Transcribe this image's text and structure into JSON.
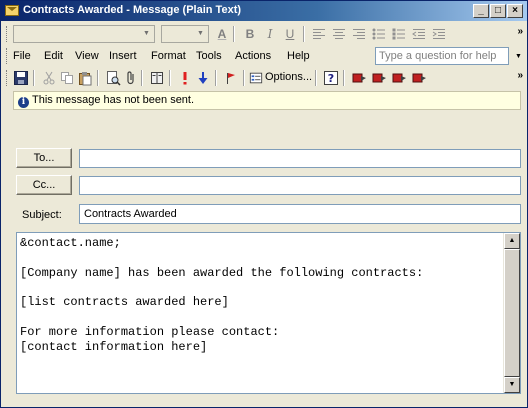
{
  "window": {
    "title": "Contracts Awarded - Message (Plain Text)",
    "controls": {
      "minimize": "_",
      "maximize": "□",
      "close": "×"
    }
  },
  "format_toolbar": {
    "font_name": "",
    "font_size": "",
    "buttons": [
      "A",
      "B",
      "I",
      "U"
    ]
  },
  "menu": {
    "items": [
      "File",
      "Edit",
      "View",
      "Insert",
      "Format",
      "Tools",
      "Actions",
      "Help"
    ],
    "accelerators": [
      "F",
      "E",
      "V",
      "I",
      "o",
      "T",
      "A",
      "H"
    ],
    "help_placeholder": "Type a question for help"
  },
  "standard_toolbar": {
    "options_label": "Options...",
    "icons": [
      "save-icon",
      "cut-icon",
      "copy-icon",
      "paste-icon",
      "print-preview-icon",
      "attach-icon",
      "address-book-icon",
      "high-importance-icon",
      "low-importance-icon",
      "flag-icon",
      "options-icon",
      "help-icon",
      "send-icon-1",
      "send-icon-2",
      "send-icon-3",
      "send-icon-4"
    ]
  },
  "info_bar": {
    "text": "This message has not been sent."
  },
  "addressing": {
    "to_label": "To...",
    "to_value": "",
    "cc_label": "Cc...",
    "cc_value": "",
    "subject_label": "Subject:",
    "subject_value": "Contracts Awarded"
  },
  "message": {
    "body": "&contact.name;\n\n[Company name] has been awarded the following contracts:\n\n[list contracts awarded here]\n\nFor more information please contact:\n[contact information here]"
  },
  "colors": {
    "title_gradient_start": "#0a246a",
    "title_gradient_end": "#a6caf0",
    "info_bar_bg": "#ffffe1",
    "window_bg": "#ece9d8",
    "field_border": "#7f9db9"
  }
}
